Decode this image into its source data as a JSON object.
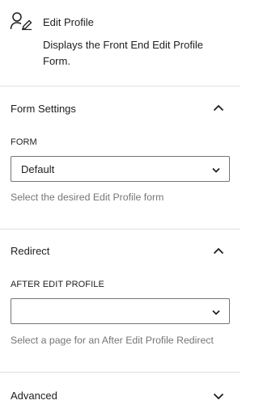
{
  "block": {
    "title": "Edit Profile",
    "description": "Displays the Front End Edit Profile Form.",
    "icon": "user-edit-icon"
  },
  "panels": [
    {
      "title": "Form Settings",
      "expanded": true,
      "field_label": "FORM",
      "select_value": "Default",
      "help": "Select the desired Edit Profile form"
    },
    {
      "title": "Redirect",
      "expanded": true,
      "field_label": "AFTER EDIT PROFILE",
      "select_value": "",
      "help": "Select a page for an After Edit Profile Redirect"
    },
    {
      "title": "Advanced",
      "expanded": false
    }
  ],
  "colors": {
    "text": "#1e1e1e",
    "muted": "#757575",
    "border": "#e0e0e0",
    "input_border": "#757575"
  }
}
